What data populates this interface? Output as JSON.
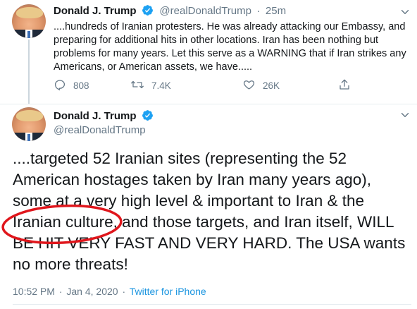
{
  "tweet1": {
    "author_name": "Donald J. Trump",
    "handle": "@realDonaldTrump",
    "separator": "·",
    "time": "25m",
    "text": "....hundreds of Iranian protesters. He was already attacking our Embassy, and preparing for additional hits in other locations. Iran has been nothing but problems for many years. Let this serve as a WARNING that if Iran strikes any Americans, or American assets, we have.....",
    "reply_count": "808",
    "retweet_count": "7.4K",
    "like_count": "26K",
    "icons": [
      "reply-icon",
      "retweet-icon",
      "like-icon",
      "share-icon",
      "chevron-down-icon",
      "verified-icon"
    ]
  },
  "tweet2": {
    "author_name": "Donald J. Trump",
    "handle": "@realDonaldTrump",
    "text": "....targeted 52 Iranian sites (representing the 52 American hostages taken by Iran many years ago), some at a very high level & important to Iran &  the Iranian culture, and those targets, and Iran itself, WILL BE HIT VERY FAST AND VERY HARD. The USA wants no more threats!",
    "time": "10:52 PM",
    "separator": "·",
    "date": "Jan 4, 2020",
    "source": "Twitter for iPhone"
  },
  "colors": {
    "text_primary": "#14171a",
    "text_secondary": "#657786",
    "link": "#1b95e0",
    "verified": "#1da1f2",
    "annotation": "#e0161c"
  }
}
